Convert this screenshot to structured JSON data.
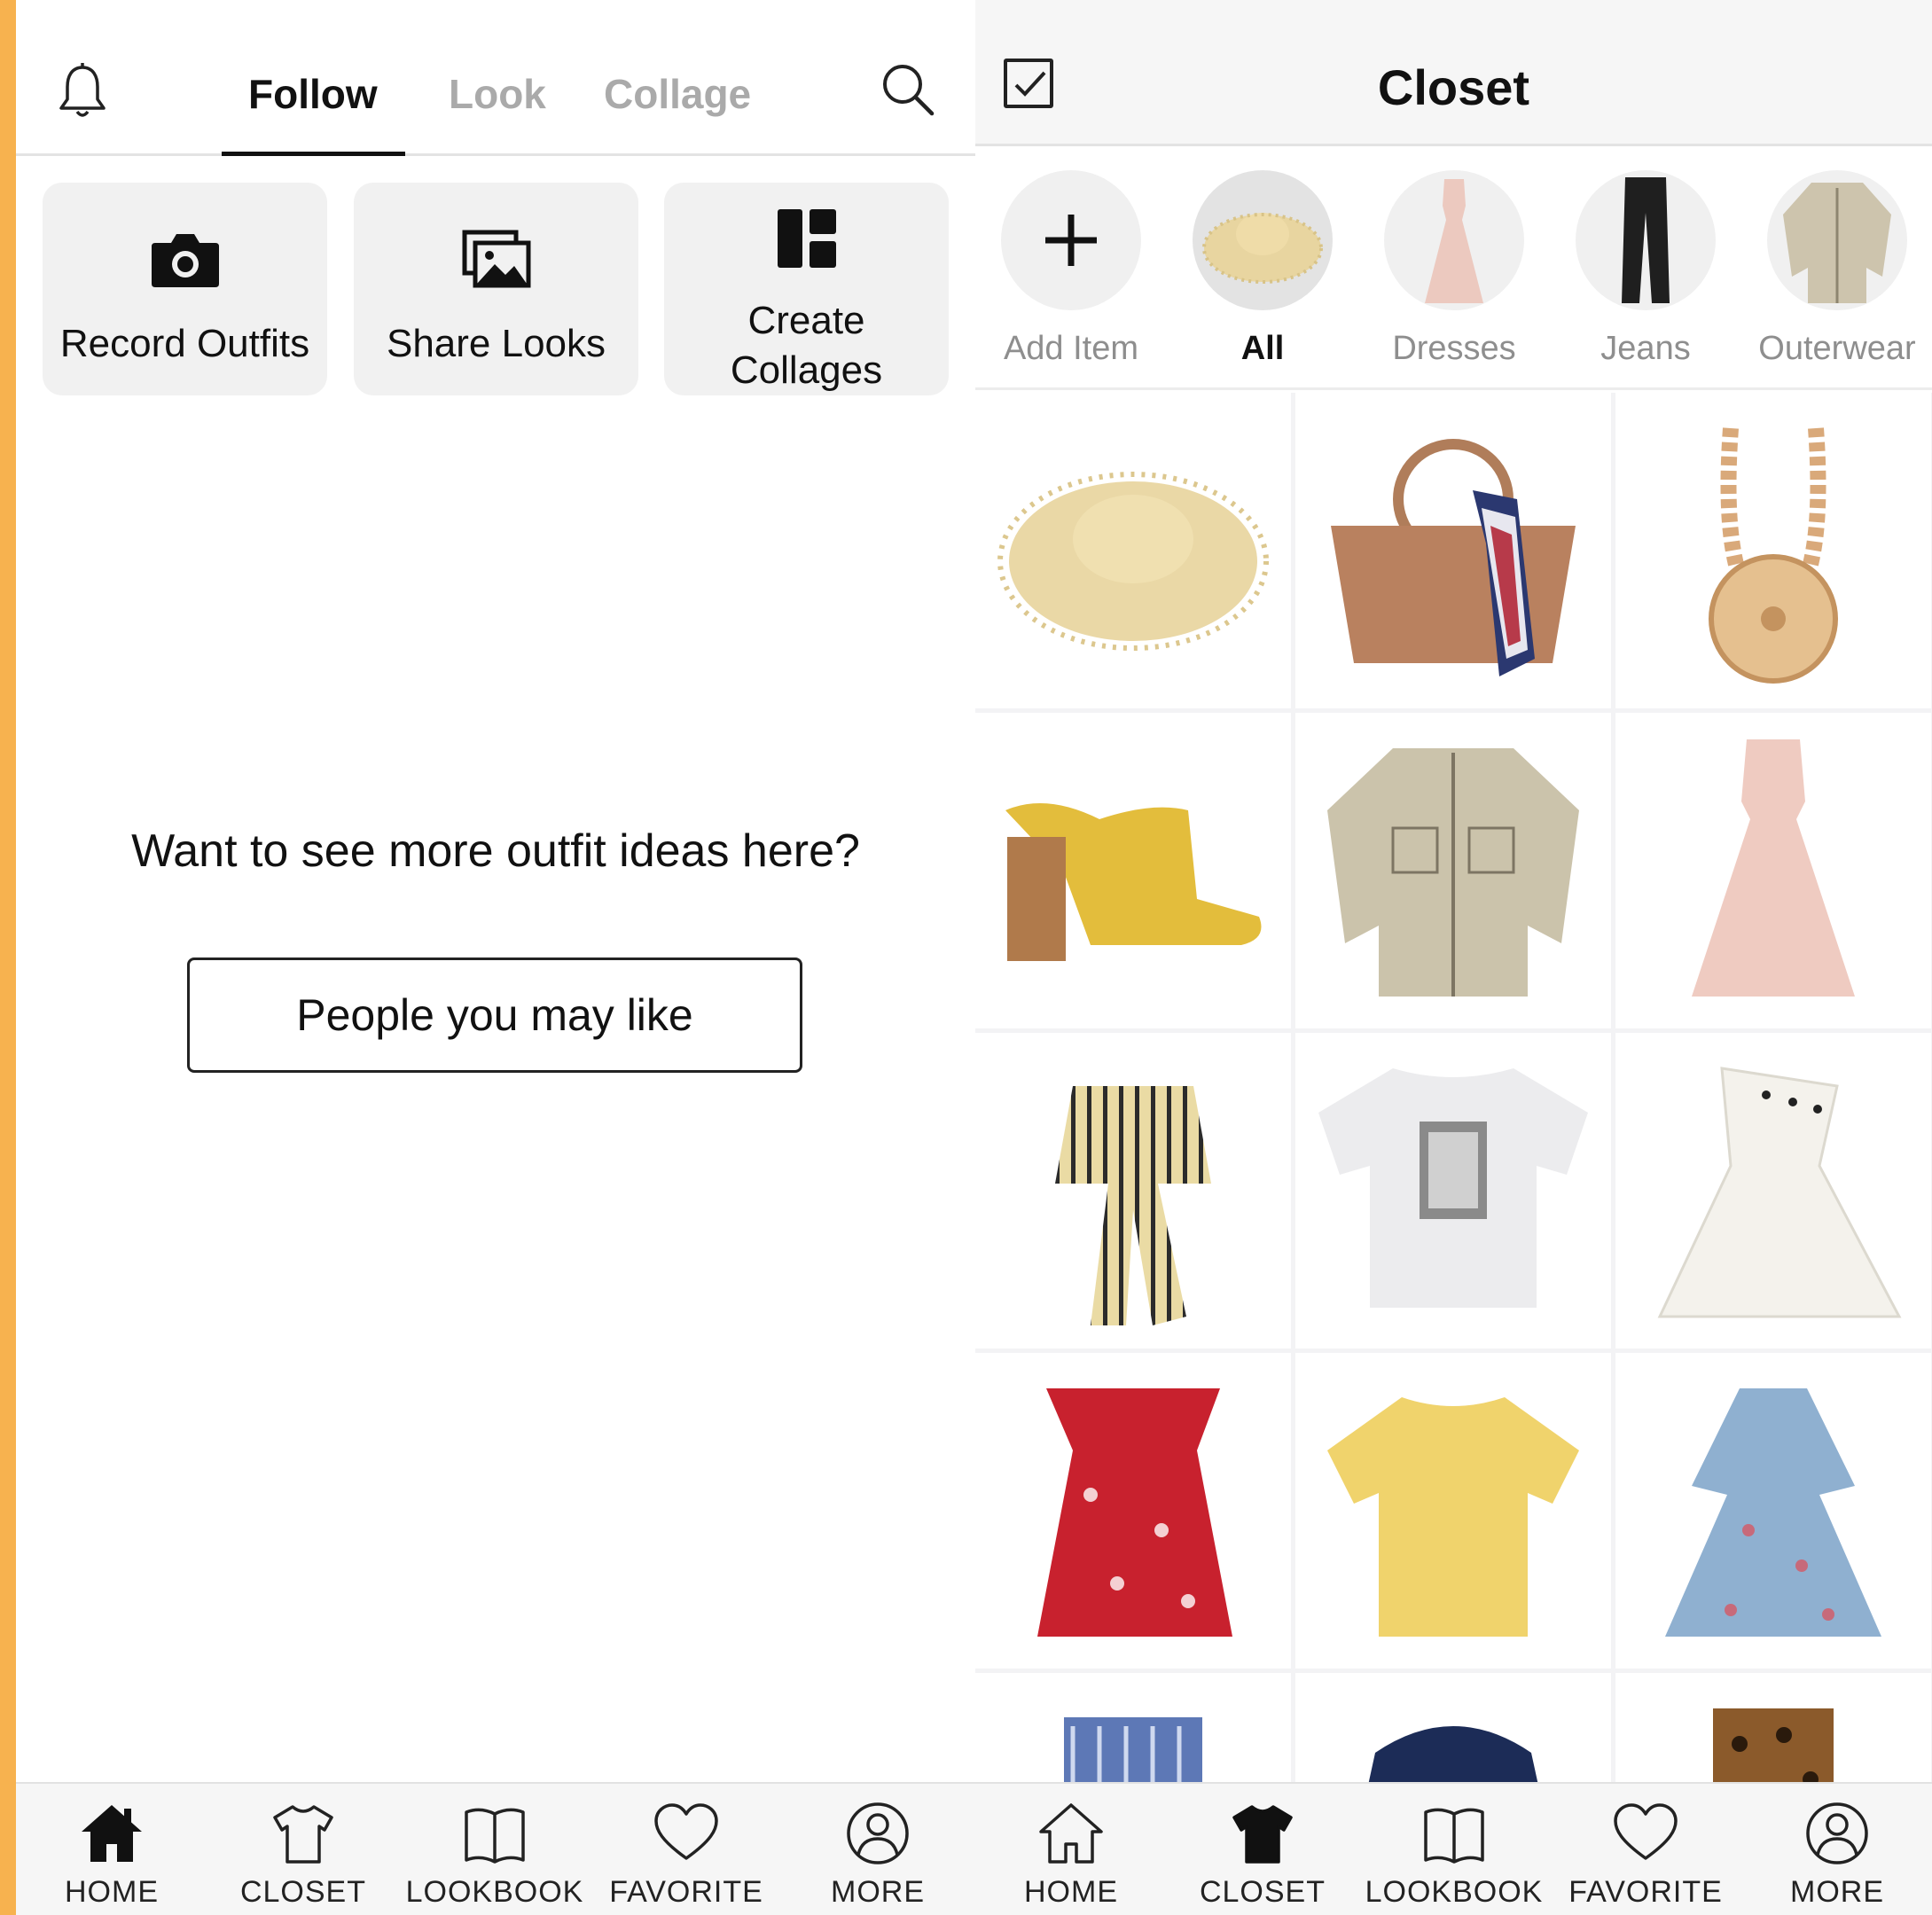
{
  "left_screen": {
    "tabs": [
      {
        "label": "Follow",
        "active": true
      },
      {
        "label": "Look",
        "active": false
      },
      {
        "label": "Collage",
        "active": false
      }
    ],
    "features": [
      {
        "label": "Record Outfits",
        "icon": "camera-icon"
      },
      {
        "label": "Share Looks",
        "icon": "photos-icon"
      },
      {
        "label": "Create Collages",
        "icon": "collage-layout-icon"
      }
    ],
    "prompt": "Want to see more outfit ideas here?",
    "people_button": "People you may like",
    "bottom_nav": [
      {
        "label": "HOME",
        "icon": "home-icon",
        "active": true
      },
      {
        "label": "CLOSET",
        "icon": "tshirt-icon",
        "active": false
      },
      {
        "label": "LOOKBOOK",
        "icon": "book-icon",
        "active": false
      },
      {
        "label": "FAVORITE",
        "icon": "heart-icon",
        "active": false
      },
      {
        "label": "MORE",
        "icon": "profile-icon",
        "active": false
      }
    ]
  },
  "right_screen": {
    "title": "Closet",
    "categories": [
      {
        "label": "Add Item",
        "icon": "plus-icon",
        "selected": false
      },
      {
        "label": "All",
        "icon": "straw-hat-thumb",
        "selected": true
      },
      {
        "label": "Dresses",
        "icon": "dress-thumb",
        "selected": false
      },
      {
        "label": "Jeans",
        "icon": "jeans-thumb",
        "selected": false
      },
      {
        "label": "Outerwear",
        "icon": "jacket-thumb",
        "selected": false
      }
    ],
    "items": [
      "straw-hat",
      "woven-bag",
      "bead-handle-bag",
      "yellow-mule",
      "utility-jacket",
      "pink-maxi-dress",
      "striped-crop-top",
      "graphic-tee",
      "white-dress",
      "red-floral-dress",
      "yellow-tee",
      "blue-floral-dress",
      "blue-striped-top",
      "navy-ruffle-top",
      "leopard-skirt"
    ],
    "bottom_nav": [
      {
        "label": "HOME",
        "icon": "home-icon",
        "active": false
      },
      {
        "label": "CLOSET",
        "icon": "tshirt-icon",
        "active": true
      },
      {
        "label": "LOOKBOOK",
        "icon": "book-icon",
        "active": false
      },
      {
        "label": "FAVORITE",
        "icon": "heart-icon",
        "active": false
      },
      {
        "label": "MORE",
        "icon": "profile-icon",
        "active": false
      }
    ]
  },
  "colors": {
    "accent_strip": "#f7b24f",
    "active_text": "#111111",
    "inactive_text": "#aaaaaa",
    "card_bg": "#f1f1f1",
    "nav_bg": "#f6f6f6"
  }
}
